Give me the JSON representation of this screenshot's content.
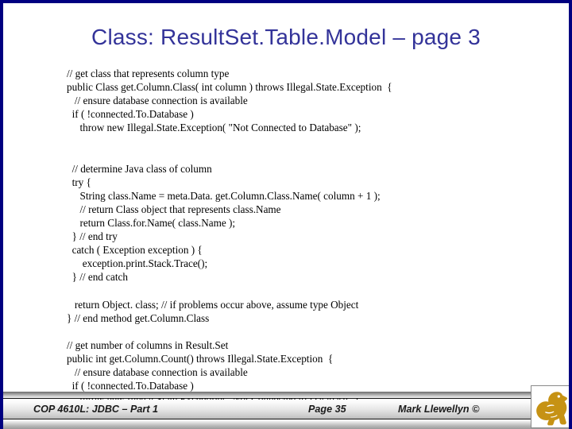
{
  "slide": {
    "title": "Class:  ResultSet.Table.Model – page 3",
    "title_color": "#333399",
    "background_color": "#ffffff",
    "border_color": "#000080"
  },
  "code": {
    "lines": [
      "// get class that represents column type",
      "public Class get.Column.Class( int column ) throws Illegal.State.Exception  {",
      "   // ensure database connection is available",
      "  if ( !connected.To.Database )",
      "     throw new Illegal.State.Exception( \"Not Connected to Database\" );",
      "",
      "",
      "  // determine Java class of column",
      "  try {",
      "     String class.Name = meta.Data. get.Column.Class.Name( column + 1 );",
      "     // return Class object that represents class.Name",
      "     return Class.for.Name( class.Name );",
      "  } // end try",
      "  catch ( Exception exception ) {",
      "      exception.print.Stack.Trace();",
      "  } // end catch",
      "",
      "   return Object. class; // if problems occur above, assume type Object",
      "} // end method get.Column.Class",
      "",
      "// get number of columns in Result.Set",
      "public int get.Column.Count() throws Illegal.State.Exception  {",
      "   // ensure database connection is available",
      "  if ( !connected.To.Database )",
      "     throw new Illegal.State.Exception( \"Not Connected to Database\" );"
    ]
  },
  "footer": {
    "course": "COP 4610L: JDBC – Part 1",
    "page": "Page 35",
    "author": "Mark Llewellyn ©",
    "logo_name": "ucf-pegasus-logo",
    "logo_color": "#c69214"
  }
}
